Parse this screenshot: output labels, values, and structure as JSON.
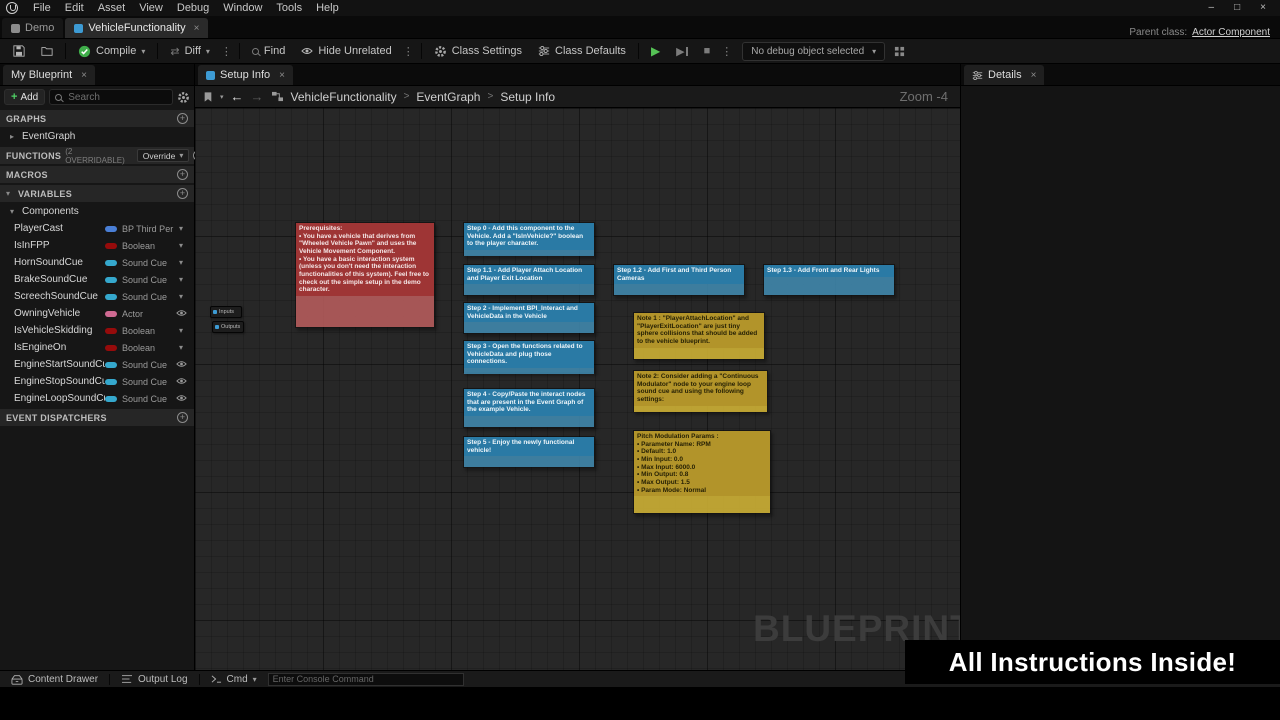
{
  "icons": {
    "close": "×",
    "chevron_down": "▾",
    "expander_down": "▾",
    "expander_right": "▸",
    "plus": "+",
    "minimize": "–",
    "maximize": "□",
    "back_arrow": "←",
    "forward_arrow": "→",
    "crumb_sep": ">",
    "play": "▶",
    "stop": "■",
    "dots": "⋮",
    "check": "✓",
    "diff_swap": "⇄"
  },
  "menu": {
    "items": [
      "File",
      "Edit",
      "Asset",
      "View",
      "Debug",
      "Window",
      "Tools",
      "Help"
    ]
  },
  "asset_tabs": {
    "demo": "Demo",
    "active": "VehicleFunctionality",
    "parent_class_label": "Parent class:",
    "parent_class_value": "Actor Component"
  },
  "toolbar": {
    "compile": "Compile",
    "diff": "Diff",
    "find": "Find",
    "hide_unrelated": "Hide Unrelated",
    "class_settings": "Class Settings",
    "class_defaults": "Class Defaults",
    "debug_select": "No debug object selected"
  },
  "my_blueprint": {
    "tab_title": "My Blueprint",
    "add_label": "Add",
    "search_placeholder": "Search",
    "graphs_header": "GRAPHS",
    "event_graph": "EventGraph",
    "functions_header": "FUNCTIONS",
    "functions_overridable": "(2 OVERRIDABLE)",
    "override_label": "Override",
    "macros_header": "MACROS",
    "variables_header": "VARIABLES",
    "components_label": "Components",
    "event_dispatchers_header": "EVENT DISPATCHERS",
    "variables": [
      {
        "name": "PlayerCast",
        "type": "BP Third Per",
        "color": "#4a7fd6"
      },
      {
        "name": "IsInFPP",
        "type": "Boolean",
        "color": "#960b0b"
      },
      {
        "name": "HornSoundCue",
        "type": "Sound Cue",
        "color": "#35a8cd"
      },
      {
        "name": "BrakeSoundCue",
        "type": "Sound Cue",
        "color": "#35a8cd"
      },
      {
        "name": "ScreechSoundCue",
        "type": "Sound Cue",
        "color": "#35a8cd"
      },
      {
        "name": "OwningVehicle",
        "type": "Actor",
        "color": "#cf6a92"
      },
      {
        "name": "IsVehicleSkidding",
        "type": "Boolean",
        "color": "#960b0b"
      },
      {
        "name": "IsEngineOn",
        "type": "Boolean",
        "color": "#960b0b"
      },
      {
        "name": "EngineStartSoundCue",
        "type": "Sound Cue",
        "color": "#35a8cd"
      },
      {
        "name": "EngineStopSoundCue",
        "type": "Sound Cue",
        "color": "#35a8cd"
      },
      {
        "name": "EngineLoopSoundCue",
        "type": "Sound Cue",
        "color": "#35a8cd"
      }
    ]
  },
  "graph": {
    "tab_title": "Setup Info",
    "breadcrumbs": [
      "VehicleFunctionality",
      "EventGraph",
      "Setup Info"
    ],
    "zoom_label": "Zoom -4",
    "watermark": "BLUEPRINT",
    "inputs_node": "Inputs",
    "outputs_node": "Outputs",
    "comments": [
      {
        "text": "Prerequisites:\n• You have a vehicle that derives from \"Wheeled Vehicle Pawn\" and uses the Vehicle Movement Component.\n• You have a basic interaction system (unless you don't need the interaction functionalities of this system). Feel free to check out the simple setup in the demo character.",
        "title_color": "#9e3535",
        "body_color": "rgba(189,95,95,0.85)",
        "text_color": "#f5e7e7"
      },
      {
        "text": "Step 0 - Add this component to the Vehicle. Add a \"IsInVehicle?\" boolean to the player character.",
        "title_color": "#2a7aa5",
        "body_color": "rgba(66,141,180,0.85)",
        "text_color": "#eef6fa"
      },
      {
        "text": "Step 1.1 - Add Player Attach Location and Player Exit Location",
        "title_color": "#2a7aa5",
        "body_color": "rgba(66,141,180,0.85)",
        "text_color": "#eef6fa"
      },
      {
        "text": "Step 1.2 - Add First and Third Person Cameras",
        "title_color": "#2a7aa5",
        "body_color": "rgba(66,141,180,0.85)",
        "text_color": "#eef6fa"
      },
      {
        "text": "Step 1.3 - Add Front and Rear Lights",
        "title_color": "#2a7aa5",
        "body_color": "rgba(66,141,180,0.85)",
        "text_color": "#eef6fa"
      },
      {
        "text": "Step 2 - Implement BPI_Interact and VehicleData in the Vehicle",
        "title_color": "#2a7aa5",
        "body_color": "rgba(66,141,180,0.85)",
        "text_color": "#eef6fa"
      },
      {
        "text": "Note 1 : \"PlayerAttachLocation\" and \"PlayerExitLocation\" are just tiny sphere collisions that should be added to the vehicle blueprint.",
        "title_color": "#b2942a",
        "body_color": "rgba(201,172,52,0.92)",
        "text_color": "#241f04"
      },
      {
        "text": "Step 3 - Open the functions related to VehicleData and plug those connections.",
        "title_color": "#2a7aa5",
        "body_color": "rgba(66,141,180,0.85)",
        "text_color": "#eef6fa"
      },
      {
        "text": "Note 2: Consider adding a \"Continuous Modulator\" node to your engine loop sound cue and using the following settings:",
        "title_color": "#b2942a",
        "body_color": "rgba(201,172,52,0.92)",
        "text_color": "#241f04"
      },
      {
        "text": "Step 4 - Copy/Paste the interact nodes that are present in the Event Graph of the example Vehicle.",
        "title_color": "#2a7aa5",
        "body_color": "rgba(66,141,180,0.85)",
        "text_color": "#eef6fa"
      },
      {
        "text": "Step 5 - Enjoy the newly functional vehicle!",
        "title_color": "#2a7aa5",
        "body_color": "rgba(66,141,180,0.85)",
        "text_color": "#eef6fa"
      },
      {
        "text": "Pitch Modulation Params :\n• Parameter Name: RPM\n• Default: 1.0\n• Min Input: 0.0\n• Max Input: 6000.0\n• Min Output: 0.8\n• Max Output: 1.5\n• Param Mode: Normal",
        "title_color": "#b2942a",
        "body_color": "rgba(201,172,52,0.92)",
        "text_color": "#241f04"
      }
    ]
  },
  "details": {
    "tab_title": "Details"
  },
  "status_bar": {
    "content_drawer": "Content Drawer",
    "output_log": "Output Log",
    "cmd": "Cmd",
    "console_placeholder": "Enter Console Command"
  },
  "banner": {
    "text": "All Instructions Inside!"
  }
}
